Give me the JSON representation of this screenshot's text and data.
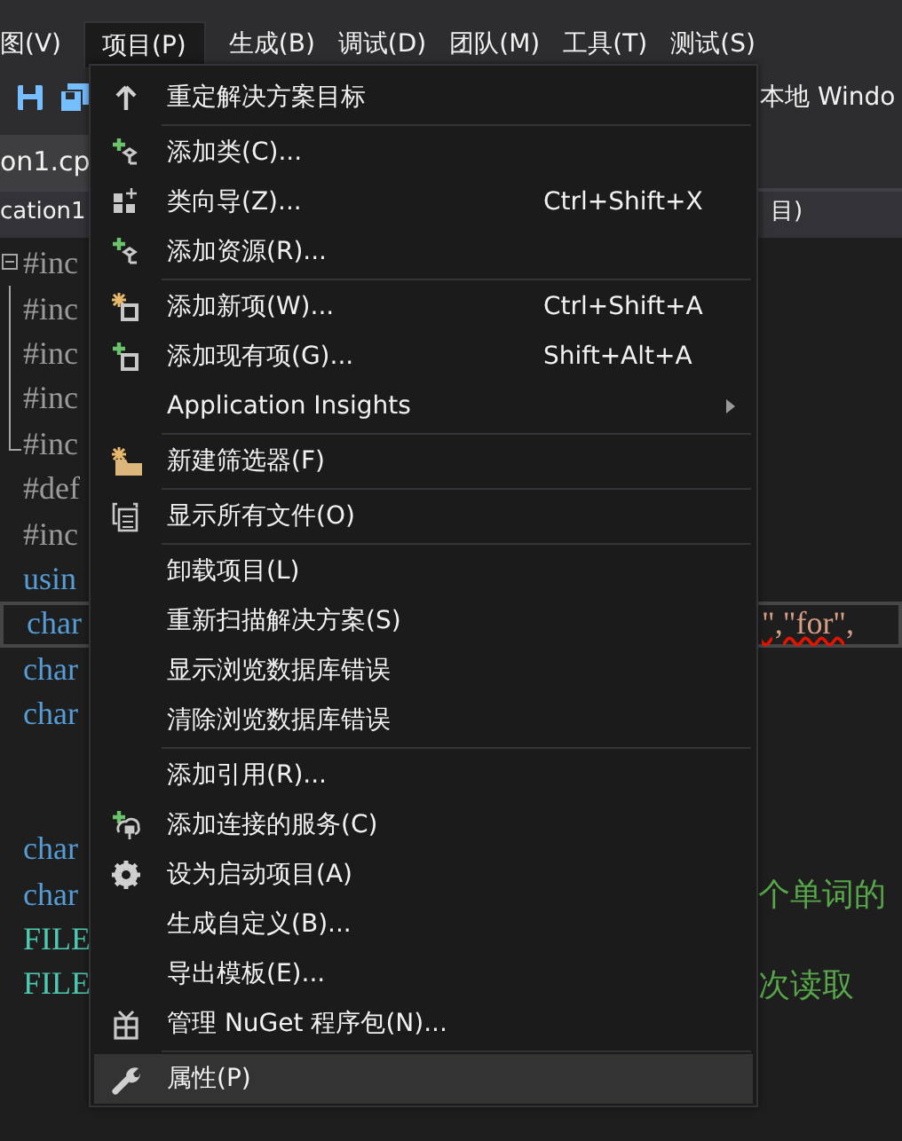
{
  "menubar": [
    {
      "label": "图(V)",
      "selected": false
    },
    {
      "label": "项目(P)",
      "selected": true
    },
    {
      "label": "生成(B)",
      "selected": false
    },
    {
      "label": "调试(D)",
      "selected": false
    },
    {
      "label": "团队(M)",
      "selected": false
    },
    {
      "label": "工具(T)",
      "selected": false
    },
    {
      "label": "测试(S)",
      "selected": false
    }
  ],
  "toolbar": {
    "target": "本地 Windo"
  },
  "tabs": [
    {
      "label": "on1.cp"
    }
  ],
  "navbar": {
    "project": "cation1",
    "scope": "目)"
  },
  "editor": {
    "lines": [
      {
        "kind": "code",
        "left": {
          "text": "#inc",
          "kind": "preprocessor"
        }
      },
      {
        "kind": "code",
        "left": {
          "text": "#inc",
          "kind": "preprocessor"
        }
      },
      {
        "kind": "code",
        "left": {
          "text": "#inc",
          "kind": "preprocessor"
        }
      },
      {
        "kind": "code",
        "left": {
          "text": "#inc",
          "kind": "preprocessor"
        }
      },
      {
        "kind": "code",
        "left": {
          "text": "#inc",
          "kind": "preprocessor"
        }
      },
      {
        "kind": "code",
        "left": {
          "text": "#def",
          "kind": "preprocessor"
        }
      },
      {
        "kind": "code",
        "left": {
          "text": "#inc",
          "kind": "preprocessor"
        }
      },
      {
        "kind": "code",
        "left": {
          "text": "usin",
          "kind": "keyword"
        }
      },
      {
        "kind": "code",
        "current": true,
        "left": {
          "text": "char",
          "kind": "keyword"
        },
        "right": {
          "text": "\",\"for\",",
          "kind": "string"
        }
      },
      {
        "kind": "code",
        "left": {
          "text": "char",
          "kind": "keyword"
        }
      },
      {
        "kind": "code",
        "left": {
          "text": "char",
          "kind": "keyword"
        }
      },
      {
        "kind": "blank"
      },
      {
        "kind": "blank"
      },
      {
        "kind": "code",
        "left": {
          "text": "char",
          "kind": "keyword"
        }
      },
      {
        "kind": "code",
        "left": {
          "text": "char",
          "kind": "keyword"
        },
        "right": {
          "text": "个单词的",
          "kind": "comment"
        }
      },
      {
        "kind": "code",
        "left": {
          "text": "FILE",
          "kind": "type"
        }
      },
      {
        "kind": "code",
        "left": {
          "text": "FILE",
          "kind": "type"
        },
        "right": {
          "text": "次读取",
          "kind": "comment"
        }
      }
    ]
  },
  "menu": {
    "items": [
      {
        "kind": "item",
        "label": "重定解决方案目标",
        "selected": false
      },
      {
        "kind": "separator"
      },
      {
        "kind": "item",
        "label": "添加类(C)...",
        "selected": false
      },
      {
        "kind": "item",
        "label": "类向导(Z)...",
        "shortcut": "Ctrl+Shift+X",
        "selected": false
      },
      {
        "kind": "item",
        "label": "添加资源(R)...",
        "selected": false
      },
      {
        "kind": "separator"
      },
      {
        "kind": "item",
        "label": "添加新项(W)...",
        "shortcut": "Ctrl+Shift+A",
        "selected": false
      },
      {
        "kind": "item",
        "label": "添加现有项(G)...",
        "shortcut": "Shift+Alt+A",
        "selected": false
      },
      {
        "kind": "item",
        "label": "Application Insights",
        "submenu": true,
        "selected": false
      },
      {
        "kind": "separator"
      },
      {
        "kind": "item",
        "label": "新建筛选器(F)",
        "selected": false
      },
      {
        "kind": "separator"
      },
      {
        "kind": "item",
        "label": "显示所有文件(O)",
        "selected": false
      },
      {
        "kind": "separator"
      },
      {
        "kind": "item",
        "label": "卸载项目(L)",
        "selected": false
      },
      {
        "kind": "item",
        "label": "重新扫描解决方案(S)",
        "selected": false
      },
      {
        "kind": "item",
        "label": "显示浏览数据库错误",
        "selected": false
      },
      {
        "kind": "item",
        "label": "清除浏览数据库错误",
        "selected": false
      },
      {
        "kind": "separator"
      },
      {
        "kind": "item",
        "label": "添加引用(R)...",
        "selected": false
      },
      {
        "kind": "item",
        "label": "添加连接的服务(C)",
        "selected": false
      },
      {
        "kind": "item",
        "label": "设为启动项目(A)",
        "selected": false
      },
      {
        "kind": "item",
        "label": "生成自定义(B)...",
        "selected": false
      },
      {
        "kind": "item",
        "label": "导出模板(E)...",
        "selected": false
      },
      {
        "kind": "item",
        "label": "管理 NuGet 程序包(N)...",
        "selected": false
      },
      {
        "kind": "separator"
      },
      {
        "kind": "item",
        "label": "属性(P)",
        "selected": true
      }
    ]
  }
}
